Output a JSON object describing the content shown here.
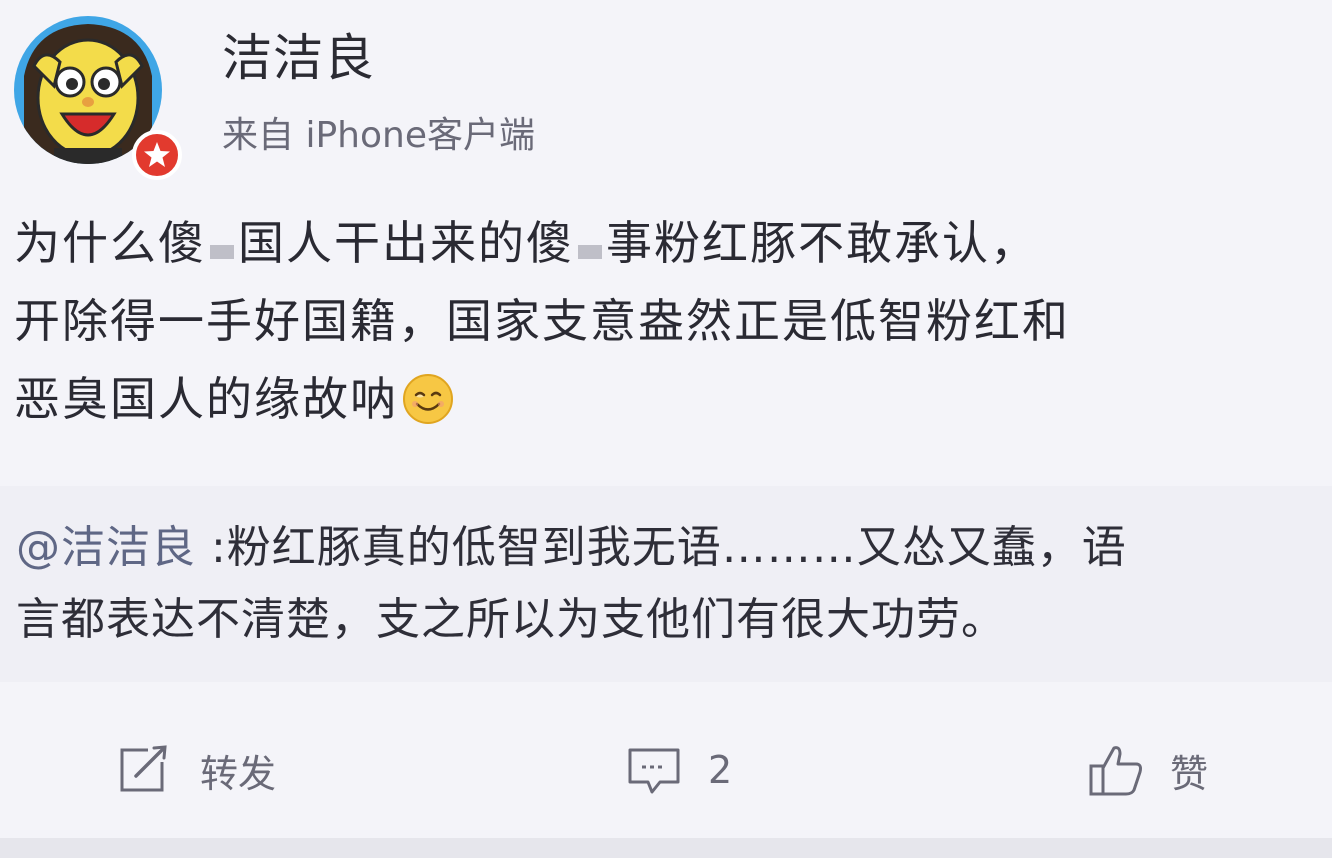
{
  "post": {
    "username": "洁洁良",
    "source": "来自 iPhone客户端",
    "text_lines": [
      {
        "seg1": "为什么傻",
        "seg2": "国人干出来的傻",
        "seg3": "事粉红豚不敢承认，"
      },
      {
        "text": "开除得一手好国籍，国家支意盎然正是低智粉红和"
      },
      {
        "text": "恶臭国人的缘故呐"
      }
    ],
    "emoji": "smile-emoji"
  },
  "repost": {
    "mention": "@洁洁良",
    "line1": " :粉红豚真的低智到我无语………又怂又蠢，语",
    "line2": "言都表达不清楚，支之所以为支他们有很大功劳。"
  },
  "actions": {
    "repost_label": "转发",
    "comment_count": "2",
    "like_label": "赞"
  },
  "colors": {
    "badge": "#e23a2e",
    "avatar_bg": "#3fa6e6",
    "text": "#2a2a33",
    "muted": "#6a6a78"
  }
}
